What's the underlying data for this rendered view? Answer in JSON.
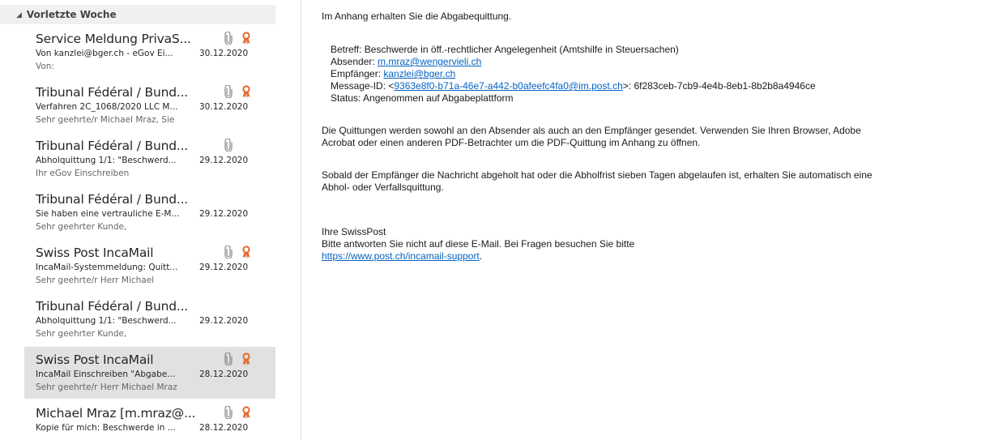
{
  "colors": {
    "accent_link": "#0563c1",
    "ribbon": "#e3692b",
    "selected_bg": "#e1e1e1"
  },
  "list": {
    "group_header": "Vorletzte Woche",
    "items": [
      {
        "sender": "Service Meldung PrivaS...",
        "subject": "Von kanzlei@bger.ch - eGov Ei...",
        "date": "30.12.2020",
        "preview": "Von:",
        "attachment": true,
        "ribbon": true,
        "selected": false
      },
      {
        "sender": "Tribunal Fédéral / Bund...",
        "subject": "Verfahren 2C_1068/2020 LLC M...",
        "date": "30.12.2020",
        "preview": "Sehr geehrte/r Michael Mraz,  Sie",
        "attachment": true,
        "ribbon": true,
        "selected": false
      },
      {
        "sender": "Tribunal Fédéral / Bund...",
        "subject": "Abholquittung 1/1: \"Beschwerd...",
        "date": "29.12.2020",
        "preview": "Ihr eGov Einschreiben",
        "attachment": true,
        "ribbon": false,
        "selected": false
      },
      {
        "sender": "Tribunal Fédéral / Bund...",
        "subject": "Sie haben eine vertrauliche E-M...",
        "date": "29.12.2020",
        "preview": "Sehr geehrter Kunde,",
        "attachment": false,
        "ribbon": false,
        "selected": false
      },
      {
        "sender": "Swiss Post IncaMail",
        "subject": "IncaMail-Systemmeldung: Quitt...",
        "date": "29.12.2020",
        "preview": "Sehr geehrte/r  Herr Michael",
        "attachment": true,
        "ribbon": true,
        "selected": false
      },
      {
        "sender": "Tribunal Fédéral / Bund...",
        "subject": "Abholquittung 1/1: \"Beschwerd...",
        "date": "29.12.2020",
        "preview": "Sehr geehrter Kunde,",
        "attachment": false,
        "ribbon": false,
        "selected": false
      },
      {
        "sender": "Swiss Post IncaMail",
        "subject": "IncaMail Einschreiben \"Abgabe...",
        "date": "28.12.2020",
        "preview": "Sehr geehrte/r Herr Michael Mraz",
        "attachment": true,
        "ribbon": true,
        "selected": true
      },
      {
        "sender": "Michael Mraz [m.mraz@...",
        "subject": "Kopie für mich: Beschwerde in ...",
        "date": "28.12.2020",
        "preview": "",
        "attachment": true,
        "ribbon": true,
        "selected": false
      }
    ]
  },
  "message": {
    "intro": "Im Anhang erhalten Sie die Abgabequittung.",
    "betreff": "Betreff: Beschwerde in öff.-rechtlicher Angelegenheit (Amtshilfe in Steuersachen)",
    "absender_label": "Absender: ",
    "absender_email": "m.mraz@wengervieli.ch",
    "empfaenger_label": "Empfänger: ",
    "empfaenger_email": "kanzlei@bger.ch",
    "msgid_label": "Message-ID: <",
    "msgid_link": "9363e8f0-b71a-46e7-a442-b0afeefc4fa0@im.post.ch",
    "msgid_rest": ">: 6f283ceb-7cb9-4e4b-8eb1-8b2b8a4946ce",
    "status": "Status: Angenommen auf Abgabeplattform",
    "para1_line1": "Die Quittungen werden sowohl an den Absender als auch an den Empfänger gesendet. Verwenden Sie Ihren Browser, Adobe",
    "para1_line2": "Acrobat oder einen anderen PDF-Betrachter um die PDF-Quittung im Anhang zu öffnen.",
    "para2_line1": "Sobald der Empfänger die Nachricht abgeholt hat oder die Abholfrist sieben Tagen abgelaufen ist, erhalten Sie automatisch eine",
    "para2_line2": "Abhol- oder Verfallsquittung.",
    "signature": "Ihre SwissPost",
    "no_reply": "Bitte antworten Sie nicht auf diese E-Mail. Bei Fragen besuchen Sie bitte",
    "support_link": "https://www.post.ch/incamail-support",
    "support_tail": "."
  }
}
